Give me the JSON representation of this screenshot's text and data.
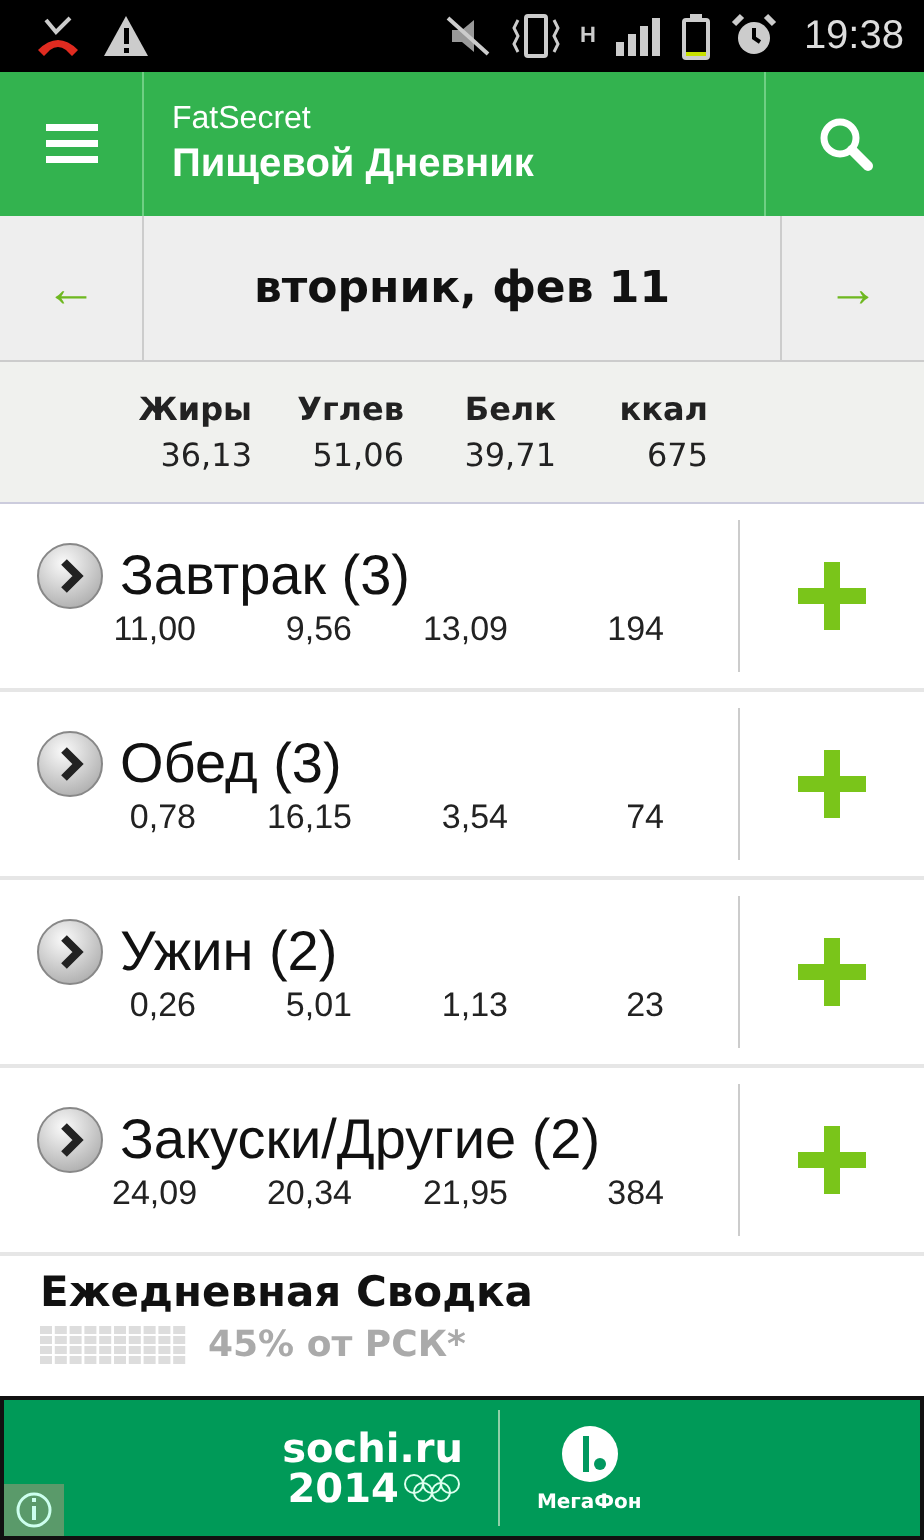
{
  "status_bar": {
    "network": "H",
    "time": "19:38"
  },
  "header": {
    "app": "FatSecret",
    "title": "Пищевой Дневник"
  },
  "date_bar": {
    "prev": "←",
    "date": "вторник, фев 11",
    "next": "→"
  },
  "totals": [
    {
      "label": "Жиры",
      "value": "36,13"
    },
    {
      "label": "Углев",
      "value": "51,06"
    },
    {
      "label": "Белк",
      "value": "39,71"
    },
    {
      "label": "ккал",
      "value": "675"
    }
  ],
  "meals": [
    {
      "name": "Завтрак (3)",
      "values": [
        "11,00",
        "9,56",
        "13,09",
        "194"
      ]
    },
    {
      "name": "Обед (3)",
      "values": [
        "0,78",
        "16,15",
        "3,54",
        "74"
      ]
    },
    {
      "name": "Ужин (2)",
      "values": [
        "0,26",
        "5,01",
        "1,13",
        "23"
      ]
    },
    {
      "name": "Закуски/Другие (2)",
      "values": [
        "24,09",
        "20,34",
        "21,95",
        "384"
      ]
    }
  ],
  "summary": {
    "title": "Ежедневная Сводка",
    "rdi": "45% от РСК*"
  },
  "ad": {
    "brand_line_1": "sochi.ru",
    "brand_line_2": "2014",
    "sponsor": "МегаФон"
  }
}
